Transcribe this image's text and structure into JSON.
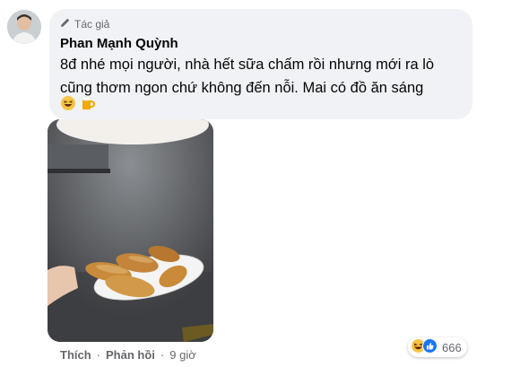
{
  "comment": {
    "badge_label": "Tác giả",
    "author": "Phan Mạnh Quỳnh",
    "text": "8đ nhé mọi người, nhà hết sữa chấm rồi nhưng mới ra lò\ncũng thơm ngon chứ không đến nỗi. Mai có đồ ăn sáng",
    "emojis": [
      "laughing-emoji",
      "beer-emoji"
    ]
  },
  "actions": {
    "like_label": "Thích",
    "reply_label": "Phản hồi",
    "separator": "·",
    "time": "9 giờ"
  },
  "reactions": {
    "types": [
      "haha-icon",
      "like-icon"
    ],
    "count": "666"
  },
  "colors": {
    "bubble": "#f0f2f5",
    "like_blue": "#1877f2",
    "haha_yellow": "#f7c545",
    "secondary_text": "#65676b"
  }
}
